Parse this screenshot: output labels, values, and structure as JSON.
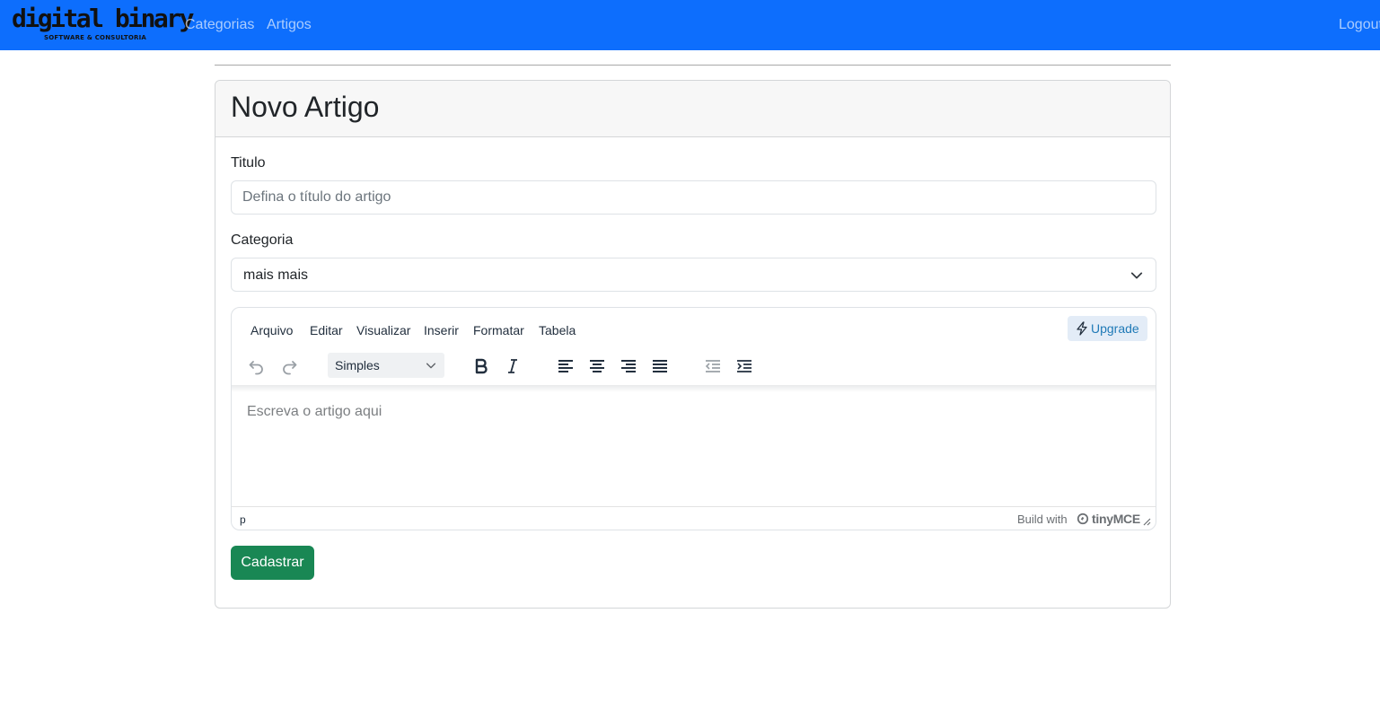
{
  "navbar": {
    "brand": {
      "name": "digital binary",
      "tagline": "SOFTWARE & CONSULTORIA"
    },
    "links": [
      "Categorias",
      "Artigos"
    ],
    "logout": "Logout",
    "color": "#0d6efd"
  },
  "card": {
    "title": "Novo Artigo",
    "form": {
      "titulo_label": "Titulo",
      "titulo_placeholder": "Defina o título do artigo",
      "titulo_value": "",
      "categoria_label": "Categoria",
      "categoria_selected": "mais mais",
      "editor": {
        "menu": [
          "Arquivo",
          "Editar",
          "Visualizar",
          "Inserir",
          "Formatar",
          "Tabela"
        ],
        "upgrade_label": "Upgrade",
        "block_format": "Simples",
        "toolbar_icons": [
          "undo-icon",
          "redo-icon",
          "bold-icon",
          "italic-icon",
          "align-left-icon",
          "align-center-icon",
          "align-right-icon",
          "align-justify-icon",
          "outdent-icon",
          "indent-icon"
        ],
        "placeholder": "Escreva o artigo aqui",
        "status_path": "p",
        "build_with": "Build with",
        "brand": "tinyMCE"
      },
      "submit_label": "Cadastrar",
      "submit_color": "#198754"
    }
  }
}
